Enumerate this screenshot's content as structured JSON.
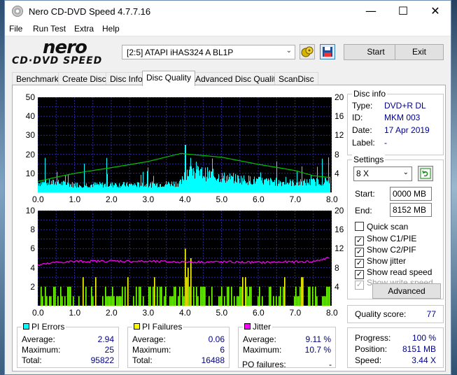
{
  "window": {
    "title": "Nero CD-DVD Speed 4.7.7.16",
    "minimize": "—",
    "maximize": "☐",
    "close": "✕"
  },
  "menu": [
    "File",
    "Run Test",
    "Extra",
    "Help"
  ],
  "logo": {
    "line1": "nero",
    "line2": "CD·DVD SPEED"
  },
  "toolbar": {
    "drive": "[2:5]   ATAPI iHAS324   A BL1P",
    "start": "Start",
    "exit": "Exit"
  },
  "tabs": [
    "Benchmark",
    "Create Disc",
    "Disc Info",
    "Disc Quality",
    "Advanced Disc Quality",
    "ScanDisc"
  ],
  "active_tab": "Disc Quality",
  "disc_info": {
    "legend": "Disc info",
    "type_label": "Type:",
    "type": "DVD+R DL",
    "id_label": "ID:",
    "id": "MKM 003",
    "date_label": "Date:",
    "date": "17 Apr 2019",
    "label_label": "Label:",
    "label": "-"
  },
  "settings": {
    "legend": "Settings",
    "speed": "8 X",
    "start_label": "Start:",
    "start": "0000 MB",
    "end_label": "End:",
    "end": "8152 MB",
    "quick_scan": "Quick scan",
    "show_c1pie": "Show C1/PIE",
    "show_c2pif": "Show C2/PIF",
    "show_jitter": "Show jitter",
    "show_read": "Show read speed",
    "show_write": "Show write speed",
    "advanced": "Advanced"
  },
  "quality": {
    "label": "Quality score:",
    "value": "77"
  },
  "progress": {
    "progress_label": "Progress:",
    "progress": "100 %",
    "position_label": "Position:",
    "position": "8151 MB",
    "speed_label": "Speed:",
    "speed": "3.44 X"
  },
  "pi_errors": {
    "legend": "PI Errors",
    "avg_label": "Average:",
    "avg": "2.94",
    "max_label": "Maximum:",
    "max": "25",
    "total_label": "Total:",
    "total": "95822",
    "color": "#00ffff"
  },
  "pi_failures": {
    "legend": "PI Failures",
    "avg_label": "Average:",
    "avg": "0.06",
    "max_label": "Maximum:",
    "max": "6",
    "total_label": "Total:",
    "total": "16488",
    "color": "#ffff00"
  },
  "jitter": {
    "legend": "Jitter",
    "avg_label": "Average:",
    "avg": "9.11 %",
    "max_label": "Maximum:",
    "max": "10.7 %",
    "po_label": "PO failures:",
    "po": "-",
    "color": "#ff00ff"
  },
  "chart_data": [
    {
      "type": "area",
      "name": "PI Errors / read speed",
      "x_ticks": [
        "0.0",
        "1.0",
        "2.0",
        "3.0",
        "4.0",
        "5.0",
        "6.0",
        "7.0",
        "8.0"
      ],
      "y_left_ticks": [
        "50",
        "40",
        "30",
        "20",
        "10"
      ],
      "y_right_ticks": [
        "20",
        "16",
        "12",
        "8",
        "4"
      ],
      "xlim": [
        0,
        8
      ],
      "ylim": [
        0,
        50
      ],
      "y2lim": [
        0,
        20
      ],
      "pi_errors_color": "#00ffff",
      "speed_color": "#00c000",
      "read_speed": {
        "x": [
          0.0,
          0.5,
          1.0,
          2.0,
          3.0,
          3.9,
          4.0,
          5.0,
          6.0,
          7.0,
          7.5,
          8.0
        ],
        "y": [
          2.3,
          3.2,
          4.0,
          5.2,
          6.5,
          8.2,
          8.1,
          7.4,
          5.9,
          4.6,
          3.5,
          3.1
        ]
      },
      "pi_errors_profile": {
        "x": [
          0.0,
          0.5,
          1.0,
          2.0,
          3.0,
          3.9,
          4.0,
          4.5,
          5.0,
          6.0,
          7.0,
          8.0
        ],
        "y": [
          5,
          5,
          4,
          4,
          4,
          5,
          11,
          10,
          8,
          6,
          5,
          6
        ]
      },
      "pi_errors_max": 25
    },
    {
      "type": "bar",
      "name": "PI Failures / jitter",
      "x_ticks": [
        "0.0",
        "1.0",
        "2.0",
        "3.0",
        "4.0",
        "5.0",
        "6.0",
        "7.0",
        "8.0"
      ],
      "y_left_ticks": [
        "10",
        "8",
        "6",
        "4",
        "2"
      ],
      "y_right_ticks": [
        "20",
        "16",
        "12",
        "8",
        "4"
      ],
      "xlim": [
        0,
        8
      ],
      "ylim": [
        0,
        10
      ],
      "y2lim": [
        0,
        20
      ],
      "pi_failures_color": "#ffff00",
      "jitter_color": "#ff00ff",
      "jitter": {
        "x": [
          0.0,
          0.5,
          1.0,
          2.0,
          3.0,
          4.0,
          5.0,
          6.0,
          7.0,
          7.5,
          8.0
        ],
        "y": [
          8.5,
          9.1,
          9.3,
          9.4,
          9.3,
          9.2,
          9.2,
          9.1,
          9.2,
          9.3,
          10.2
        ]
      },
      "pi_failures_max": 6
    }
  ]
}
